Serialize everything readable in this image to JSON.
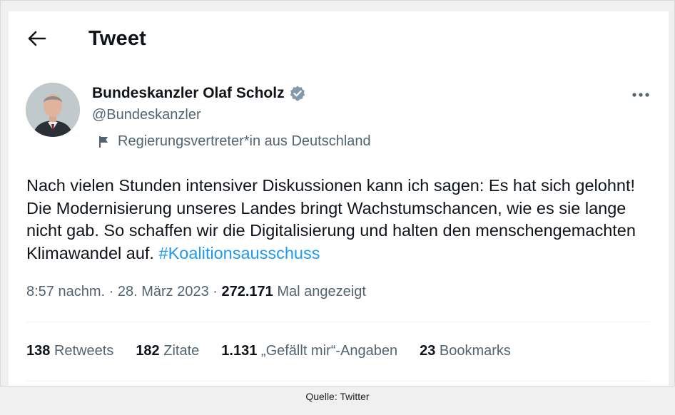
{
  "header": {
    "title": "Tweet",
    "back_icon": "arrow-left-icon"
  },
  "author": {
    "name": "Bundeskanzler Olaf Scholz",
    "handle": "@Bundeskanzler",
    "verified_icon": "verified-badge-icon",
    "verified_color": "#829aab",
    "label": "Regierungsvertreter*in aus Deutschland",
    "label_icon": "flag-icon"
  },
  "more_icon": "more-horizontal-icon",
  "tweet": {
    "text": "Nach vielen Stunden intensiver Diskussionen kann ich sagen: Es hat sich gelohnt! Die Modernisierung unseres Landes bringt Wachstumschancen, wie es sie lange nicht gab. So schaffen wir die Digitalisierung und halten den menschengemachten Klimawandel auf.",
    "hashtag": "#Koalitionsausschuss",
    "hashtag_color": "#1d9bf0"
  },
  "meta": {
    "time": "8:57 nachm.",
    "separator": " · ",
    "date": "28. März 2023",
    "views": "272.171",
    "views_label": "Mal angezeigt"
  },
  "stats": [
    {
      "count": "138",
      "label": "Retweets"
    },
    {
      "count": "182",
      "label": "Zitate"
    },
    {
      "count": "1.131",
      "label": "„Gefällt mir“-Angaben"
    },
    {
      "count": "23",
      "label": "Bookmarks"
    }
  ],
  "caption": "Quelle: Twitter"
}
